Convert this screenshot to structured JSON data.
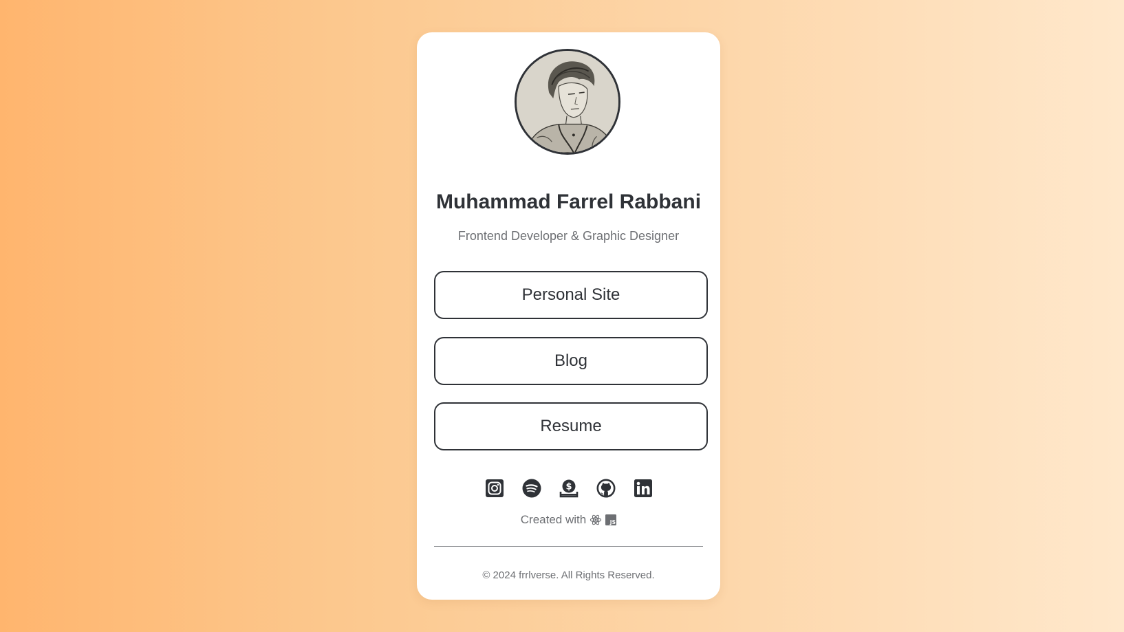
{
  "profile": {
    "name": "Muhammad Farrel Rabbani",
    "subtitle": "Frontend Developer & Graphic Designer",
    "avatar_alt": "sketch-portrait"
  },
  "links": [
    {
      "label": "Personal Site"
    },
    {
      "label": "Blog"
    },
    {
      "label": "Resume"
    }
  ],
  "socials": [
    {
      "icon": "instagram-icon"
    },
    {
      "icon": "spotify-icon"
    },
    {
      "icon": "donate-icon"
    },
    {
      "icon": "github-icon"
    },
    {
      "icon": "linkedin-icon"
    }
  ],
  "created_with": {
    "text": "Created with",
    "icons": [
      "react-icon",
      "javascript-icon"
    ]
  },
  "footer": {
    "copyright": "© 2024 frrlverse. All Rights Reserved."
  },
  "colors": {
    "text_dark": "#2f3237",
    "text_muted": "#6d6f73",
    "card": "#ffffff",
    "gradient_start": "#ffb56e",
    "gradient_end": "#ffe8cc"
  }
}
